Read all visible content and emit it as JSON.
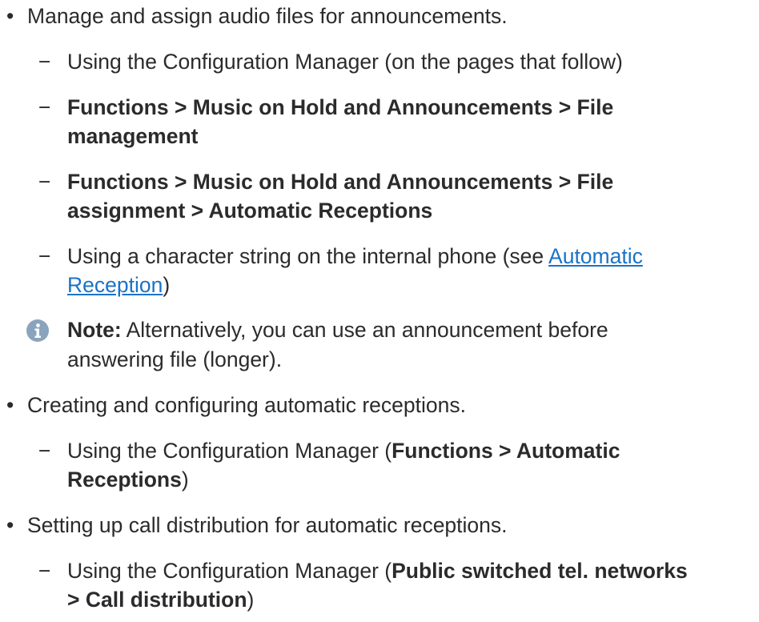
{
  "items": {
    "b1": "Manage and assign audio files for announcements.",
    "b1_s1": "Using the Configuration Manager (on the pages that follow)",
    "b1_s2_l1": "Functions > Music on Hold and Announcements > File",
    "b1_s2_l2": "management",
    "b1_s3_l1": "Functions > Music on Hold and Announcements > File",
    "b1_s3_l2": "assignment > Automatic Receptions",
    "b1_s4_pre": "Using a character string on the internal phone (see ",
    "b1_s4_link1": "Automatic",
    "b1_s4_link2": "Reception",
    "b1_s4_post": ")",
    "note_label": "Note:",
    "note_l1": " Alternatively, you can use an announcement before",
    "note_l2": "answering file (longer).",
    "b2": "Creating and configuring automatic receptions.",
    "b2_s1_pre": "Using the Configuration Manager (",
    "b2_s1_bold1": "Functions > Automatic",
    "b2_s1_bold2": "Receptions",
    "b2_s1_post": ")",
    "b3": "Setting up call distribution for automatic receptions.",
    "b3_s1_pre": "Using the Configuration Manager (",
    "b3_s1_bold1": "Public switched tel. networks",
    "b3_s1_bold2": "> Call distribution",
    "b3_s1_post": ")"
  },
  "symbols": {
    "bullet": "•",
    "dash": "−"
  },
  "colors": {
    "text": "#2b2b2b",
    "link": "#1a73c6",
    "note_icon": "#8aa4bd"
  },
  "icons": {
    "note": "info-icon"
  }
}
